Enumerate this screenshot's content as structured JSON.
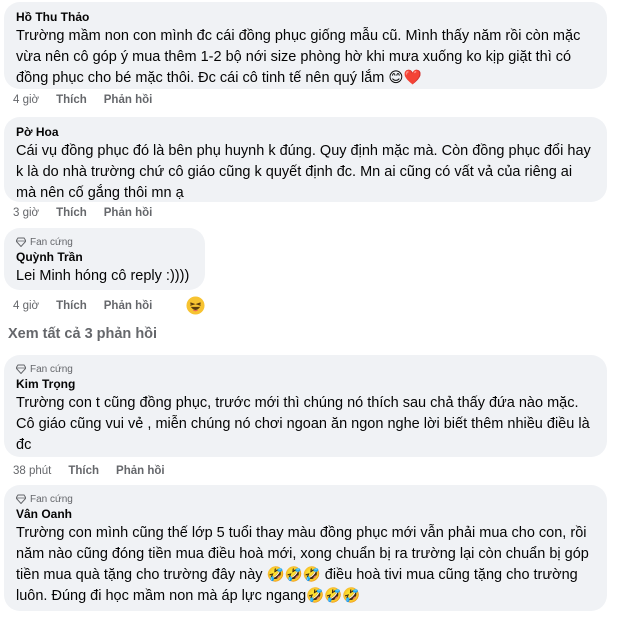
{
  "comments": [
    {
      "author": "Hồ Thu Thảo",
      "text": "Trường mầm non con mình đc cái đồng phục giống mẫu cũ. Mình thấy năm rồi còn mặc vừa nên cô góp ý mua thêm 1-2 bộ nới size phòng hờ khi mưa xuống ko kịp giặt thì có đồng phục cho bé mặc thôi. Đc cái cô tinh tế nên quý lắm 😊❤️",
      "time": "4 giờ",
      "like": "Thích",
      "reply": "Phản hồi"
    },
    {
      "author": "Pờ Hoa",
      "text": "Cái vụ đồng phục đó là bên phụ huynh k đúng. Quy định mặc mà. Còn đồng phục đổi hay k là do nhà trường chứ cô giáo cũng k quyết định đc. Mn ai cũng có vất vả của riêng ai mà nên cố gắng thôi mn ạ",
      "time": "3 giờ",
      "like": "Thích",
      "reply": "Phản hồi"
    },
    {
      "badge": "Fan cứng",
      "author": "Quỳnh Trần",
      "mention": "Lei Minh",
      "text": " hóng cô reply :))))",
      "time": "4 giờ",
      "like": "Thích",
      "reply": "Phản hồi",
      "reaction": "laughing-emoji"
    },
    {
      "badge": "Fan cứng",
      "author": "Kim Trọng",
      "text": "Trường con t cũng đồng phục, trước mới thì chúng nó thích sau chả thấy đứa nào mặc. Cô giáo cũng vui vẻ , miễn chúng nó chơi ngoan ăn ngon nghe lời biết thêm nhiều điều là đc",
      "time": "38 phút",
      "like": "Thích",
      "reply": "Phản hồi"
    },
    {
      "badge": "Fan cứng",
      "author": "Vân Oanh",
      "text": "Trường con mình cũng thế lớp 5 tuổi thay màu đồng phục mới vẫn phải mua cho con, rồi năm nào cũng đóng tiền mua điều hoà mới, xong chuẩn bị ra trường lại còn chuẩn bị góp tiền mua quà tặng cho trường đây này 🤣🤣🤣 điều hoà tivi mua cũng tặng cho trường luôn. Đúng đi học mầm non mà áp lực ngang🤣🤣🤣",
      "time": "",
      "like": "",
      "reply": ""
    }
  ],
  "see_all": "Xem tất cả 3 phản hồi",
  "colors": {
    "bubble": "#f0f2f5",
    "meta": "#65676b",
    "text": "#050505"
  }
}
